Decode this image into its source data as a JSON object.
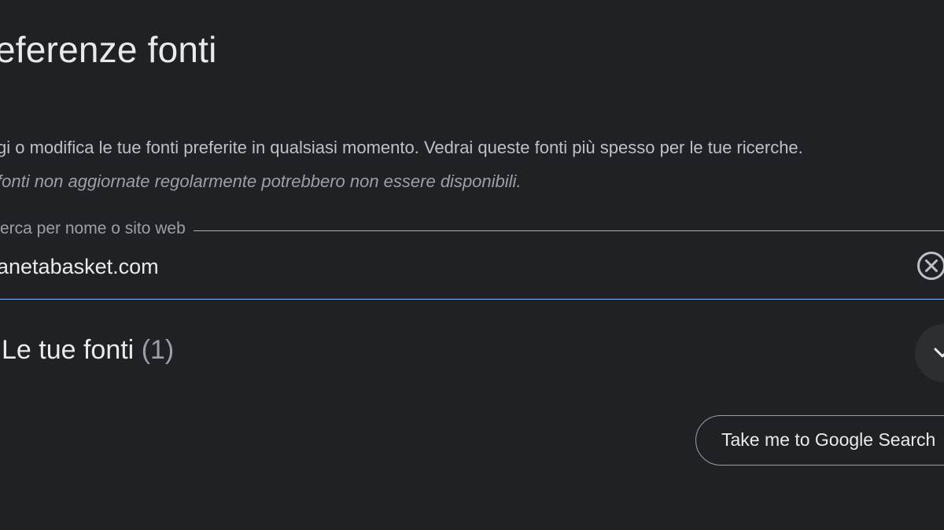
{
  "header": {
    "title": "eferenze fonti"
  },
  "intro": {
    "description": "gi o modifica le tue fonti preferite in qualsiasi momento. Vedrai queste fonti più spesso per le tue ricerche.",
    "note": "fonti non aggiornate regolarmente potrebbero non essere disponibili."
  },
  "search": {
    "label": "erca per nome o sito web",
    "value": "anetabasket.com",
    "clear_icon": "close-circle-icon"
  },
  "sources": {
    "heading": "Le tue fonti",
    "count": "(1)",
    "expand_icon": "chevron-down-icon"
  },
  "actions": {
    "google_search_label": "Take me to Google Search"
  },
  "colors": {
    "background": "#202124",
    "accent": "#8ab4f8",
    "text": "#e8eaed",
    "muted": "#9aa0a6"
  }
}
